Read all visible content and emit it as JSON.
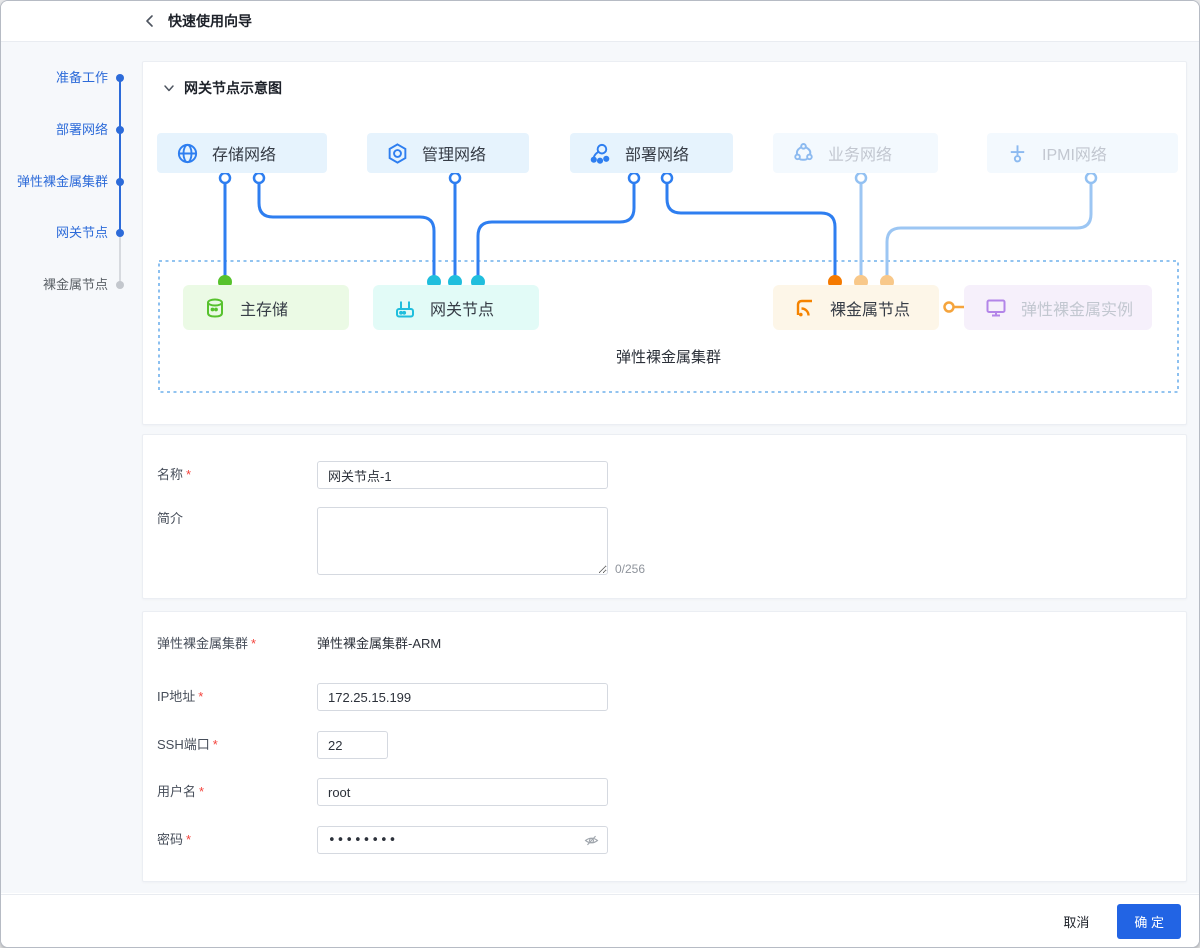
{
  "header": {
    "title": "快速使用向导"
  },
  "stepper": {
    "steps": [
      {
        "label": "准备工作",
        "state": "active"
      },
      {
        "label": "部署网络",
        "state": "active"
      },
      {
        "label": "弹性裸金属集群",
        "state": "active"
      },
      {
        "label": "网关节点",
        "state": "current"
      },
      {
        "label": "裸金属节点",
        "state": "pending"
      }
    ]
  },
  "diagram": {
    "title": "网关节点示意图",
    "cluster_label": "弹性裸金属集群",
    "networks": [
      {
        "label": "存储网络",
        "icon": "globe-icon",
        "active": true
      },
      {
        "label": "管理网络",
        "icon": "hex-gear-icon",
        "active": true
      },
      {
        "label": "部署网络",
        "icon": "cluster-icon",
        "active": true
      },
      {
        "label": "业务网络",
        "icon": "cloud-nodes-icon",
        "active": false
      },
      {
        "label": "IPMI网络",
        "icon": "probe-icon",
        "active": false
      }
    ],
    "nodes": [
      {
        "label": "主存储",
        "icon": "database-icon"
      },
      {
        "label": "网关节点",
        "icon": "router-icon"
      },
      {
        "label": "裸金属节点",
        "icon": "rss-icon"
      },
      {
        "label": "弹性裸金属实例",
        "icon": "monitor-icon"
      }
    ]
  },
  "form_basic": {
    "name_label": "名称",
    "name_value": "网关节点-1",
    "desc_label": "简介",
    "desc_value": "",
    "desc_counter": "0/256"
  },
  "form_conn": {
    "cluster_label": "弹性裸金属集群",
    "cluster_value": "弹性裸金属集群-ARM",
    "ip_label": "IP地址",
    "ip_value": "172.25.15.199",
    "ssh_label": "SSH端口",
    "ssh_value": "22",
    "user_label": "用户名",
    "user_value": "root",
    "pwd_label": "密码",
    "pwd_value": "••••••••"
  },
  "footer": {
    "cancel_label": "取消",
    "confirm_label": "确 定"
  },
  "ui": {
    "required": "*"
  },
  "colors": {
    "accent": "#2d6bd9",
    "accent2": "#2264e4",
    "line-blue": "#2e7ef0",
    "line-light": "#9cc6f3",
    "green": "#57c22d",
    "cyan": "#20bedd",
    "orange": "#f58300",
    "orange-light": "#f8c88a",
    "purple": "#b385e8"
  }
}
